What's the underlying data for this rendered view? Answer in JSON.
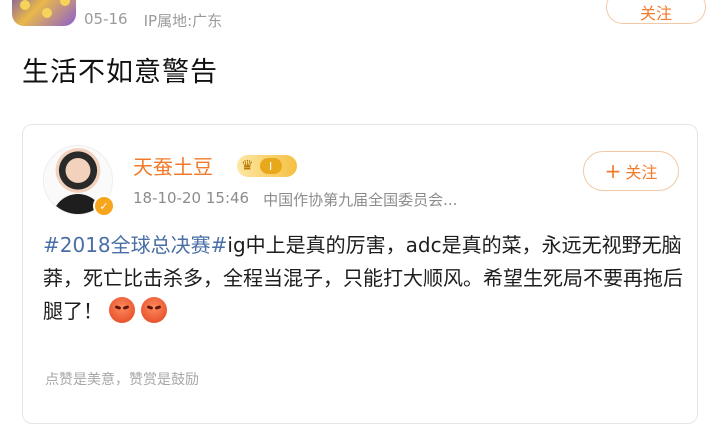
{
  "post": {
    "date": "05-16",
    "ip_location": "IP属地:广东",
    "follow_label": "关注",
    "title": "生活不如意警告"
  },
  "quoted": {
    "author": "天蚕土豆",
    "level": "I",
    "datetime": "18-10-20 15:46",
    "source": "中国作协第九届全国委员会...",
    "follow_label": "关注",
    "hashtag": "#2018全球总决赛#",
    "body": "ig中上是真的厉害，adc是真的菜，永远无视野无脑莽，死亡比击杀多，全程当混子，只能打大顺风。希望生死局不要再拖后腿了！",
    "footer": "点赞是美意，赞赏是鼓励",
    "colors": {
      "accent": "#f27a2a",
      "hashtag": "#4a6fa6"
    },
    "icons": [
      "crown-icon",
      "verified-icon",
      "angry-emoji-icon"
    ]
  }
}
